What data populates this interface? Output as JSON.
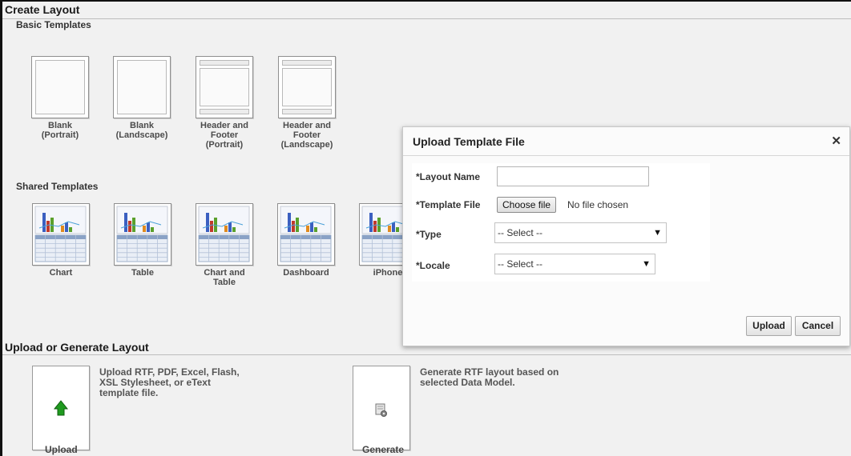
{
  "create_layout": {
    "title": "Create Layout",
    "basic_templates": {
      "title": "Basic Templates",
      "items": [
        {
          "line1": "Blank",
          "line2": "(Portrait)",
          "line3": ""
        },
        {
          "line1": "Blank",
          "line2": "(Landscape)",
          "line3": ""
        },
        {
          "line1": "Header and",
          "line2": "Footer",
          "line3": "(Portrait)"
        },
        {
          "line1": "Header and",
          "line2": "Footer",
          "line3": "(Landscape)"
        }
      ]
    },
    "shared_templates": {
      "title": "Shared Templates",
      "items": [
        {
          "line1": "Chart",
          "line2": ""
        },
        {
          "line1": "Table",
          "line2": ""
        },
        {
          "line1": "Chart and",
          "line2": "Table"
        },
        {
          "line1": "Dashboard",
          "line2": ""
        },
        {
          "line1": "iPhone",
          "line2": ""
        }
      ]
    }
  },
  "upload_generate": {
    "title": "Upload or Generate Layout",
    "upload": {
      "label": "Upload",
      "desc_line1": "Upload RTF, PDF, Excel, Flash,",
      "desc_line2": "XSL Stylesheet, or eText",
      "desc_line3": "template file."
    },
    "generate": {
      "label": "Generate",
      "desc_line1": "Generate RTF layout based on",
      "desc_line2": "selected Data Model."
    }
  },
  "dialog": {
    "title": "Upload Template File",
    "close": "✕",
    "fields": {
      "layout_name_label": "*Layout Name",
      "layout_name_value": "",
      "template_file_label": "*Template File",
      "choose_file": "Choose file",
      "no_file": "No file chosen",
      "type_label": "*Type",
      "type_value": "-- Select --",
      "locale_label": "*Locale",
      "locale_value": "-- Select --"
    },
    "buttons": {
      "upload": "Upload",
      "cancel": "Cancel"
    }
  },
  "colors": {
    "upload_arrow": "#1f9a1f",
    "chart_blue": "#3b5fc0",
    "chart_red": "#c0392b",
    "chart_green": "#5aa02c",
    "chart_orange": "#e08a1e"
  },
  "icons": {
    "upload": "green-up-arrow-icon",
    "generate": "document-gear-icon",
    "close": "close-icon"
  }
}
